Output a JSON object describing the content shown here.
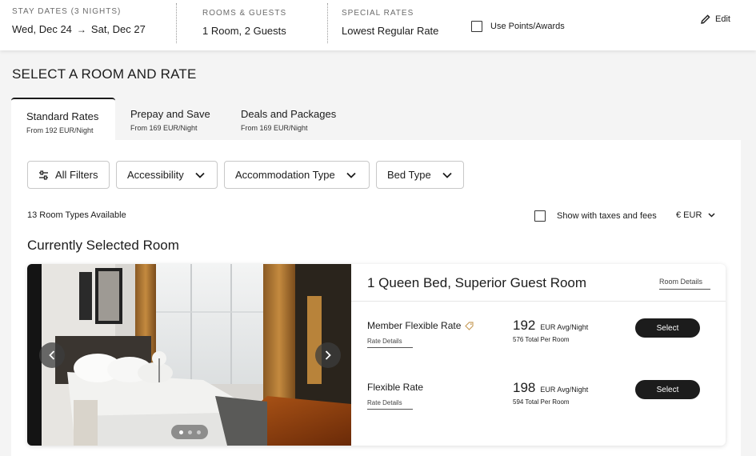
{
  "header": {
    "stay_label": "STAY DATES (3 NIGHTS)",
    "checkin": "Wed, Dec 24",
    "checkout": "Sat, Dec 27",
    "rooms_label": "ROOMS & GUESTS",
    "rooms_value": "1 Room, 2 Guests",
    "rates_label": "SPECIAL RATES",
    "rates_value": "Lowest Regular Rate",
    "points_label": "Use Points/Awards",
    "points_checked": false,
    "edit_label": "Edit"
  },
  "page_title": "SELECT A ROOM AND RATE",
  "tabs": [
    {
      "label": "Standard Rates",
      "sub": "From 192 EUR/Night",
      "active": true
    },
    {
      "label": "Prepay and Save",
      "sub": "From 169 EUR/Night",
      "active": false
    },
    {
      "label": "Deals and Packages",
      "sub": "From 169 EUR/Night",
      "active": false
    }
  ],
  "filters": {
    "all_filters": "All Filters",
    "accessibility": "Accessibility",
    "accommodation": "Accommodation Type",
    "bed_type": "Bed Type"
  },
  "results": {
    "count": "13 Room Types Available",
    "taxes_label": "Show with taxes and fees",
    "taxes_checked": false,
    "currency": "€ EUR"
  },
  "selected_heading": "Currently Selected Room",
  "room": {
    "name": "1 Queen Bed, Superior Guest Room",
    "details_link": "Room Details",
    "photo_count": 3,
    "photo_index": 1,
    "rates": [
      {
        "name": "Member Flexible Rate",
        "member_tag": true,
        "link": "Rate Details",
        "price": "192",
        "unit": "EUR Avg/Night",
        "total": "576 Total Per Room",
        "button": "Select"
      },
      {
        "name": "Flexible Rate",
        "member_tag": false,
        "link": "Rate Details",
        "price": "198",
        "unit": "EUR Avg/Night",
        "total": "594 Total Per Room",
        "button": "Select"
      }
    ]
  },
  "colors": {
    "accent": "#1c1c1c",
    "page_bg": "#f4f4f4",
    "member_tag": "#c9a060"
  }
}
